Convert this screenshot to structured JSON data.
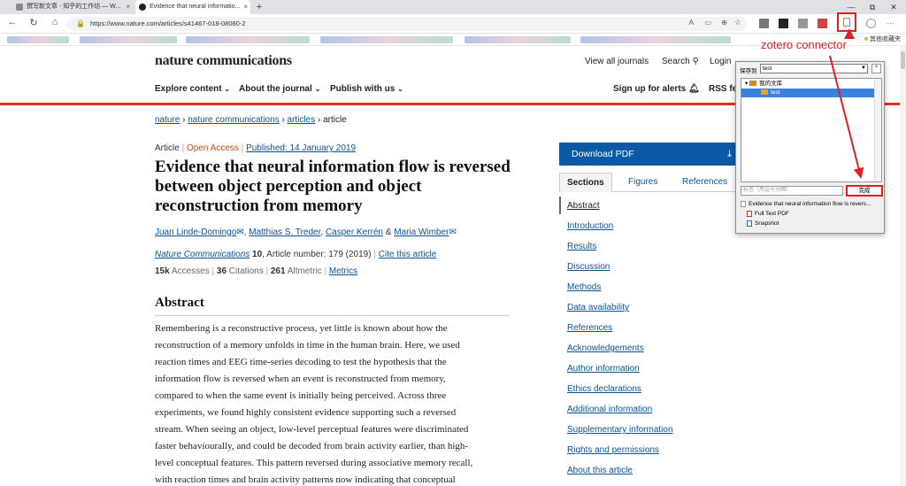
{
  "browser": {
    "tabs": [
      {
        "title": "撰写新文章 - 知乎的工作坊 — W...",
        "active": false
      },
      {
        "title": "Evidence that neural informatio...",
        "active": true
      }
    ],
    "new_tab": "+",
    "window_controls": [
      "—",
      "⧉",
      "✕"
    ],
    "url": "https://www.nature.com/articles/s41467-018-08080-2",
    "other_bookmarks": "其他收藏夹",
    "more": "···"
  },
  "site": {
    "logo": "nature communications",
    "view_all_journals": "View all journals",
    "search": "Search",
    "login": "Login",
    "nav": {
      "explore": "Explore content",
      "about": "About the journal",
      "publish": "Publish with us",
      "signup": "Sign up for alerts",
      "rss": "RSS fe"
    }
  },
  "breadcrumb": [
    "nature",
    "nature communications",
    "articles",
    "article"
  ],
  "article": {
    "type": "Article",
    "access": "Open Access",
    "published": "Published: 14 January 2019",
    "title": "Evidence that neural information flow is reversed between object perception and object reconstruction from memory",
    "authors": [
      "Juan Linde-Domingo",
      "Matthias S. Treder",
      "Casper Kerrén",
      "Maria Wimber"
    ],
    "journal": "Nature Communications",
    "volume": "10",
    "article_number": ", Article number: 179 (2019)",
    "cite": "Cite this article",
    "accesses_n": "15k",
    "accesses": "Accesses",
    "citations_n": "36",
    "citations": "Citations",
    "altmetric_n": "261",
    "altmetric": "Altmetric",
    "metrics": "Metrics",
    "abstract_heading": "Abstract",
    "abstract_lines": [
      "Remembering is a reconstructive process, yet little is known about how the",
      "reconstruction of a memory unfolds in time in the human brain. Here, we used",
      "reaction times and EEG time-series decoding to test the hypothesis that the",
      "information flow is reversed when an event is reconstructed from memory,",
      "compared to when the same event is initially being perceived. Across three",
      "experiments, we found highly consistent evidence supporting such a reversed",
      "stream. When seeing an object, low-level perceptual features were discriminated",
      "faster behaviourally, and could be decoded from brain activity earlier, than high-",
      "level conceptual features. This pattern reversed during associative memory recall,",
      "with reaction times and brain activity patterns now indicating that conceptual"
    ]
  },
  "sidebar": {
    "download": "Download PDF",
    "tabs": [
      "Sections",
      "Figures",
      "References"
    ],
    "sections": [
      "Abstract",
      "Introduction",
      "Results",
      "Discussion",
      "Methods",
      "Data availability",
      "References",
      "Acknowledgements",
      "Author information",
      "Ethics declarations",
      "Additional information",
      "Supplementary information",
      "Rights and permissions",
      "About this article"
    ]
  },
  "zotero": {
    "save_to": "保存到",
    "collection": "test",
    "tree": [
      {
        "label": "我的文库",
        "level": 0,
        "selected": false
      },
      {
        "label": "test",
        "level": 1,
        "selected": true
      }
    ],
    "tags_placeholder": "标签（用逗号分隔）",
    "done": "完成",
    "items": [
      "Evidence that neural information flow is revers...",
      "Full Text PDF",
      "Snapshot"
    ]
  },
  "annotation": {
    "label": "zotero connector",
    "color": "#e02020"
  }
}
